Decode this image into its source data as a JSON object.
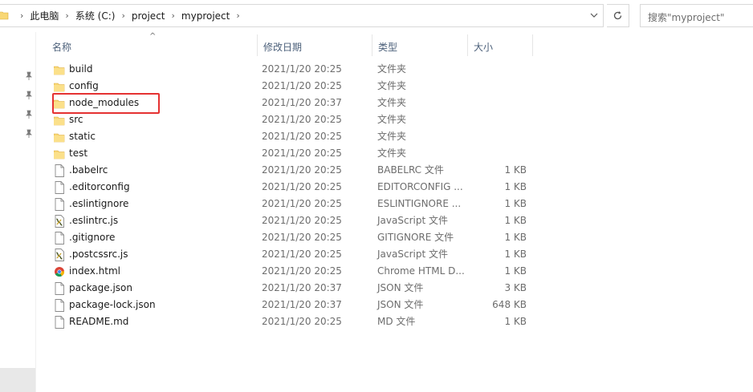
{
  "breadcrumb": {
    "items": [
      "此电脑",
      "系统 (C:)",
      "project",
      "myproject"
    ]
  },
  "search": {
    "placeholder": "搜索\"myproject\""
  },
  "columns": {
    "name": "名称",
    "date": "修改日期",
    "type": "类型",
    "size": "大小"
  },
  "files": [
    {
      "name": "build",
      "date": "2021/1/20 20:25",
      "type": "文件夹",
      "size": "",
      "icon": "folder-icon"
    },
    {
      "name": "config",
      "date": "2021/1/20 20:25",
      "type": "文件夹",
      "size": "",
      "icon": "folder-icon"
    },
    {
      "name": "node_modules",
      "date": "2021/1/20 20:37",
      "type": "文件夹",
      "size": "",
      "icon": "folder-icon"
    },
    {
      "name": "src",
      "date": "2021/1/20 20:25",
      "type": "文件夹",
      "size": "",
      "icon": "folder-icon"
    },
    {
      "name": "static",
      "date": "2021/1/20 20:25",
      "type": "文件夹",
      "size": "",
      "icon": "folder-icon"
    },
    {
      "name": "test",
      "date": "2021/1/20 20:25",
      "type": "文件夹",
      "size": "",
      "icon": "folder-icon"
    },
    {
      "name": ".babelrc",
      "date": "2021/1/20 20:25",
      "type": "BABELRC 文件",
      "size": "1 KB",
      "icon": "file-icon"
    },
    {
      "name": ".editorconfig",
      "date": "2021/1/20 20:25",
      "type": "EDITORCONFIG ...",
      "size": "1 KB",
      "icon": "file-icon"
    },
    {
      "name": ".eslintignore",
      "date": "2021/1/20 20:25",
      "type": "ESLINTIGNORE ...",
      "size": "1 KB",
      "icon": "file-icon"
    },
    {
      "name": ".eslintrc.js",
      "date": "2021/1/20 20:25",
      "type": "JavaScript 文件",
      "size": "1 KB",
      "icon": "js-file-icon"
    },
    {
      "name": ".gitignore",
      "date": "2021/1/20 20:25",
      "type": "GITIGNORE 文件",
      "size": "1 KB",
      "icon": "file-icon"
    },
    {
      "name": ".postcssrc.js",
      "date": "2021/1/20 20:25",
      "type": "JavaScript 文件",
      "size": "1 KB",
      "icon": "js-file-icon"
    },
    {
      "name": "index.html",
      "date": "2021/1/20 20:25",
      "type": "Chrome HTML D...",
      "size": "1 KB",
      "icon": "chrome-icon"
    },
    {
      "name": "package.json",
      "date": "2021/1/20 20:37",
      "type": "JSON 文件",
      "size": "3 KB",
      "icon": "file-icon"
    },
    {
      "name": "package-lock.json",
      "date": "2021/1/20 20:37",
      "type": "JSON 文件",
      "size": "648 KB",
      "icon": "file-icon"
    },
    {
      "name": "README.md",
      "date": "2021/1/20 20:25",
      "type": "MD 文件",
      "size": "1 KB",
      "icon": "file-icon"
    }
  ],
  "colors": {
    "folder": "#f8d775",
    "highlight": "#e53232",
    "header_text": "#4c607a"
  }
}
